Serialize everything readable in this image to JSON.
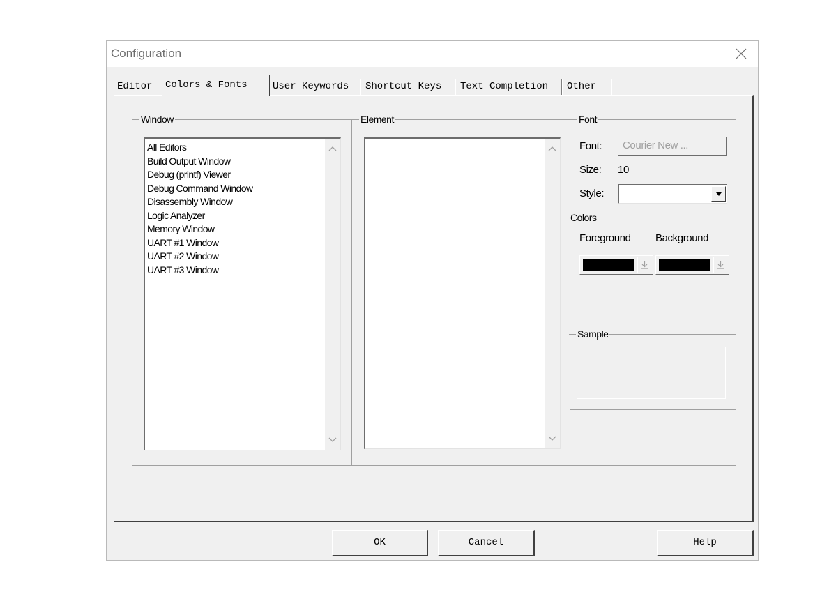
{
  "window": {
    "title": "Configuration"
  },
  "tabs": [
    {
      "label": "Editor"
    },
    {
      "label": "Colors & Fonts"
    },
    {
      "label": "User Keywords"
    },
    {
      "label": "Shortcut Keys"
    },
    {
      "label": "Text Completion"
    },
    {
      "label": "Other"
    }
  ],
  "active_tab": "Colors & Fonts",
  "window_group": {
    "label": "Window",
    "items": [
      "All Editors",
      "Build Output Window",
      "Debug (printf) Viewer",
      "Debug Command Window",
      "Disassembly Window",
      "Logic Analyzer",
      "Memory Window",
      "UART #1 Window",
      "UART #2 Window",
      "UART #3 Window"
    ]
  },
  "element_group": {
    "label": "Element",
    "items": []
  },
  "font_group": {
    "label": "Font",
    "font_label": "Font:",
    "font_button": "Courier New ...",
    "size_label": "Size:",
    "size_value": "10",
    "style_label": "Style:",
    "style_value": ""
  },
  "colors_group": {
    "label": "Colors",
    "foreground_label": "Foreground",
    "background_label": "Background",
    "foreground_color": "#000000",
    "background_color": "#000000"
  },
  "sample_group": {
    "label": "Sample"
  },
  "buttons": {
    "ok": "OK",
    "cancel": "Cancel",
    "help": "Help"
  }
}
